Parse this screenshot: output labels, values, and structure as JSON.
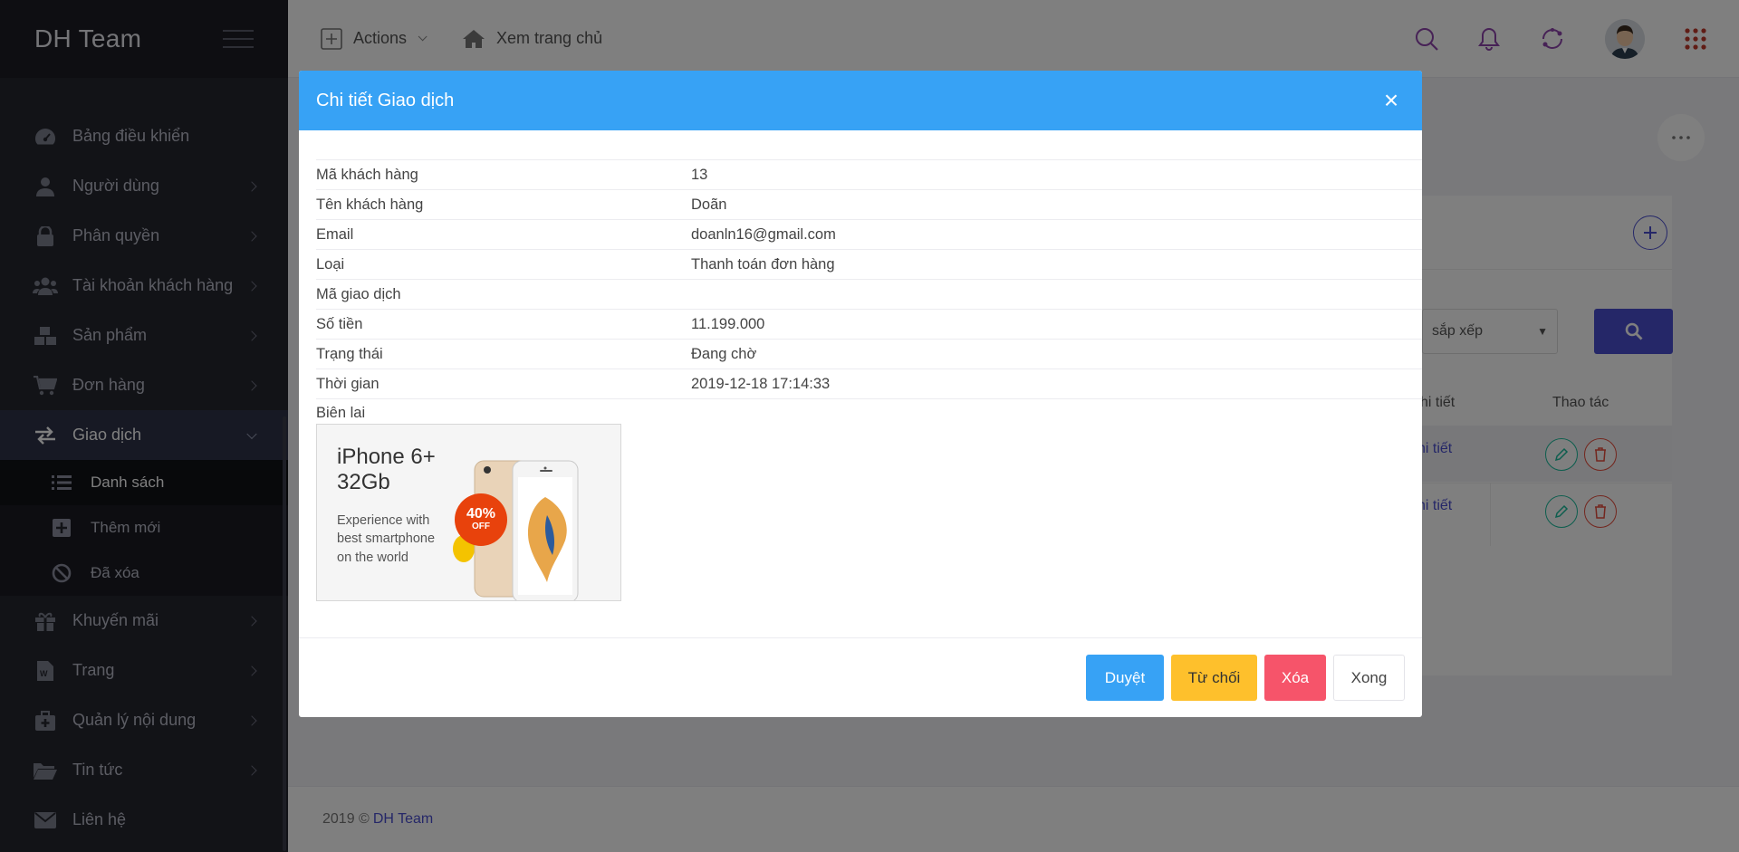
{
  "sidebar": {
    "brand": "DH Team",
    "items": [
      {
        "label": "Bảng điều khiển",
        "icon": "dashboard-icon"
      },
      {
        "label": "Người dùng",
        "icon": "user-icon"
      },
      {
        "label": "Phân quyền",
        "icon": "lock-icon"
      },
      {
        "label": "Tài khoản khách hàng",
        "icon": "users-icon"
      },
      {
        "label": "Sản phẩm",
        "icon": "cubes-icon"
      },
      {
        "label": "Đơn hàng",
        "icon": "cart-icon"
      },
      {
        "label": "Giao dịch",
        "icon": "exchange-icon"
      }
    ],
    "sub_items": [
      {
        "label": "Danh sách",
        "icon": "list-icon"
      },
      {
        "label": "Thêm mới",
        "icon": "plus-square-icon"
      },
      {
        "label": "Đã xóa",
        "icon": "ban-icon"
      }
    ],
    "items_after": [
      {
        "label": "Khuyến mãi",
        "icon": "gift-icon"
      },
      {
        "label": "Trang",
        "icon": "page-icon"
      },
      {
        "label": "Quản lý nội dung",
        "icon": "medkit-icon"
      },
      {
        "label": "Tin tức",
        "icon": "folder-icon"
      },
      {
        "label": "Liên hệ",
        "icon": "envelope-icon"
      }
    ]
  },
  "topbar": {
    "actions_label": "Actions",
    "home_label": "Xem trang chủ"
  },
  "main": {
    "sort_placeholder": "sắp xếp",
    "col_detail": "hi tiết",
    "col_actions": "Thao tác",
    "row_link": "hi tiết"
  },
  "footer": {
    "prefix": "2019 ©",
    "brand": "DH Team"
  },
  "modal": {
    "title": "Chi tiết Giao dịch",
    "close": "×",
    "rows": [
      {
        "key": "Mã khách hàng",
        "value": "13"
      },
      {
        "key": "Tên khách hàng",
        "value": "Doãn"
      },
      {
        "key": "Email",
        "value": "doanln16@gmail.com"
      },
      {
        "key": "Loại",
        "value": "Thanh toán đơn hàng"
      },
      {
        "key": "Mã giao dịch",
        "value": ""
      },
      {
        "key": "Số tiền",
        "value": "11.199.000"
      },
      {
        "key": "Trạng thái",
        "value": "Đang chờ"
      },
      {
        "key": "Thời gian",
        "value": "2019-12-18 17:14:33"
      }
    ],
    "receipt_label": "Biên lai",
    "receipt_image": {
      "title_line1": "iPhone 6+",
      "title_line2": "32Gb",
      "desc": "Experience with best smartphone on the world",
      "badge_pct": "40%",
      "badge_off": "OFF"
    },
    "buttons": {
      "approve": "Duyệt",
      "reject": "Từ chối",
      "delete": "Xóa",
      "done": "Xong"
    }
  }
}
